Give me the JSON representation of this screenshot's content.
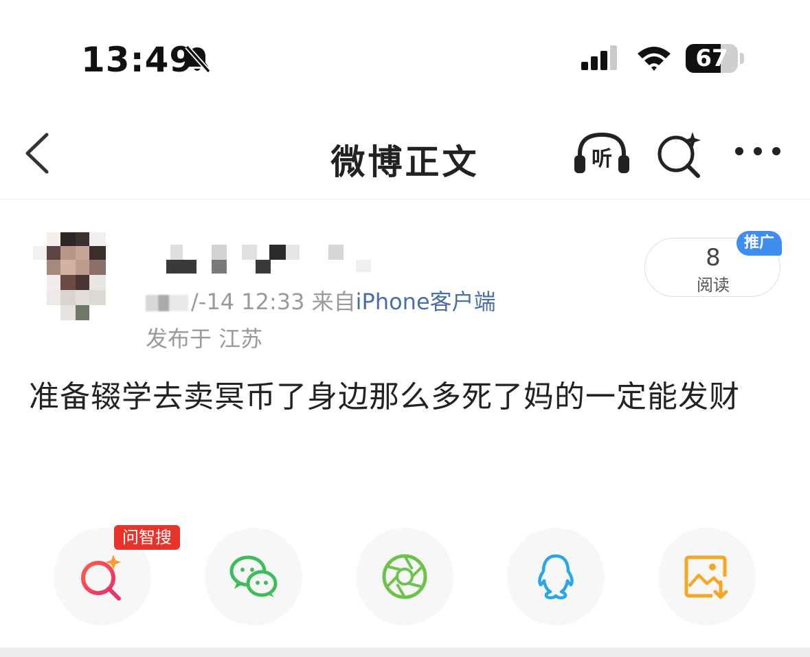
{
  "status_bar": {
    "time": "13:49",
    "battery_level": "67",
    "battery_fraction": 0.67
  },
  "nav": {
    "title": "微博正文",
    "listen_label": "听"
  },
  "post": {
    "timestamp_visible": "/-14 12:33",
    "source_prefix": "来自",
    "source_client": "iPhone客户端",
    "location": "发布于 江苏",
    "read_count": "8",
    "read_label": "阅读",
    "promo_badge": "推广",
    "content": "准备辍学去卖冥币了身边那么多死了妈的一定能发财"
  },
  "share": {
    "badge": "问智搜",
    "items": [
      {
        "icon": "ai-search-icon",
        "color": "#f0433f"
      },
      {
        "icon": "wechat-icon",
        "color": "#3fbd5a"
      },
      {
        "icon": "moments-icon",
        "color": "#6cc24a"
      },
      {
        "icon": "qq-icon",
        "color": "#29a6e8"
      },
      {
        "icon": "save-image-icon",
        "color": "#f5a623"
      }
    ]
  },
  "colors": {
    "link_blue": "#4a6fa5",
    "promo_blue": "#3d8ef0",
    "badge_red": "#e8332b"
  }
}
